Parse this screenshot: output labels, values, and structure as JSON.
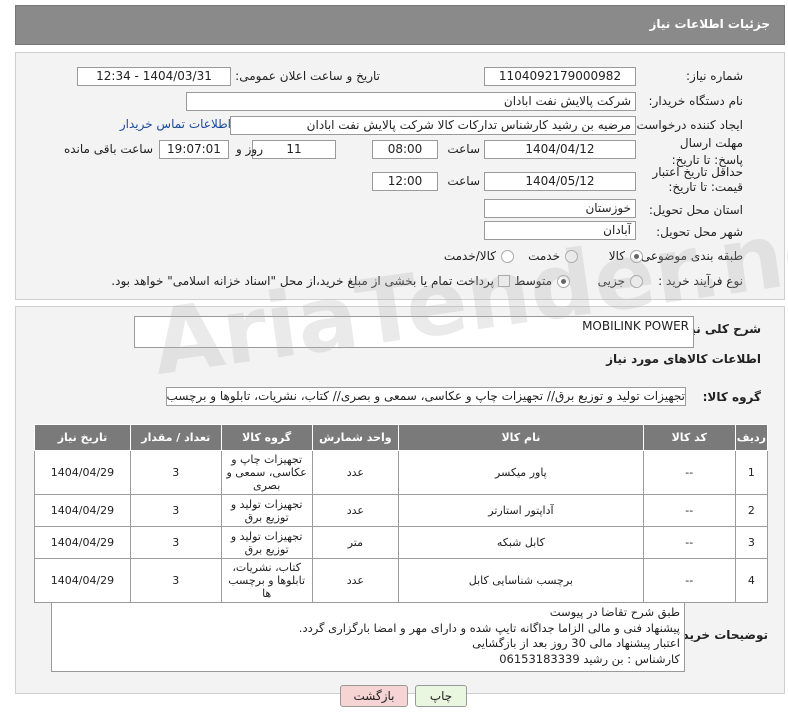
{
  "header": {
    "title": "جزئیات اطلاعات نیاز"
  },
  "form": {
    "need_number_label": "شماره نیاز:",
    "need_number": "1104092179000982",
    "announce_label": "تاریخ و ساعت اعلان عمومی:",
    "announce_value": "1404/03/31 - 12:34",
    "buyer_org_label": "نام دستگاه خریدار:",
    "buyer_org": "شرکت پالایش نفت ابادان",
    "creator_label": "ایجاد کننده درخواست:",
    "creator": "مرضیه بن رشید کارشناس تداركات كالا  شركت پالایش نفت ابادان",
    "contact_link": "اطلاعات تماس خریدار",
    "deadline_label": "مهلت ارسال پاسخ: تا تاریخ:",
    "deadline_date": "1404/04/12",
    "time_label": "ساعت",
    "deadline_time": "08:00",
    "days_value": "11",
    "days_label": "روز و",
    "remaining_time": "19:07:01",
    "remaining_label": "ساعت باقی مانده",
    "validity_label": "حداقل تاریخ اعتبار قیمت: تا تاریخ:",
    "validity_date": "1404/05/12",
    "validity_time": "12:00",
    "province_label": "استان محل تحویل:",
    "province": "خوزستان",
    "city_label": "شهر محل تحویل:",
    "city": "آبادان",
    "category_label": "طبقه بندی موضوعی:",
    "category_options": [
      "کالا",
      "خدمت",
      "کالا/خدمت"
    ],
    "category_selected": "کالا",
    "process_label": "نوع فرآیند خرید :",
    "process_options": [
      "جزیی",
      "متوسط"
    ],
    "process_selected": "متوسط",
    "payment_note": "پرداخت تمام یا بخشی از مبلغ خرید،از محل \"اسناد خزانه اسلامی\" خواهد بود."
  },
  "summary": {
    "label": "شرح کلی نیاز:",
    "value": "MOBILINK POWER",
    "items_title": "اطلاعات کالاهای مورد نیاز",
    "group_label": "گروه کالا:",
    "group_value": "تجهیزات تولید و توزیع برق// تجهیزات چاپ و عکاسی، سمعی و بصری// کتاب، نشریات، تابلوها و برچسب ها"
  },
  "table": {
    "headers": [
      "ردیف",
      "کد کالا",
      "نام کالا",
      "واحد شمارش",
      "گروه کالا",
      "تعداد / مقدار",
      "تاریخ نیاز"
    ],
    "rows": [
      [
        "1",
        "--",
        "پاور میکسر",
        "عدد",
        "تجهیزات چاپ و عکاسی، سمعی و بصری",
        "3",
        "1404/04/29"
      ],
      [
        "2",
        "--",
        "آداپتور استارتر",
        "عدد",
        "تجهیزات تولید و توزیع برق",
        "3",
        "1404/04/29"
      ],
      [
        "3",
        "--",
        "کابل شبکه",
        "متر",
        "تجهیزات تولید و توزیع برق",
        "3",
        "1404/04/29"
      ],
      [
        "4",
        "--",
        "برچسب شناسایی کابل",
        "عدد",
        "کتاب، نشریات، تابلوها و برچسب ها",
        "3",
        "1404/04/29"
      ]
    ]
  },
  "buyer_notes": {
    "label": "توضیحات خریدار:",
    "lines": [
      "طبق شرح تقاضا در پیوست",
      "پیشنهاد فنی و مالی الزاما جداگانه تایپ شده و دارای مهر و امضا بارگزاری گردد.",
      "اعتبار پیشنهاد مالی 30 روز بعد از بازگشایی",
      "کارشناس : بن رشید 06153183339"
    ]
  },
  "buttons": {
    "print": "چاپ",
    "back": "بازگشت"
  },
  "watermark": "AriaTender.net",
  "colors": {
    "header_bg": "#8a8a8a",
    "table_header_bg": "#7a7a7a",
    "back_button_bg": "#f6d4d4",
    "print_button_bg": "#e9f7e0"
  }
}
